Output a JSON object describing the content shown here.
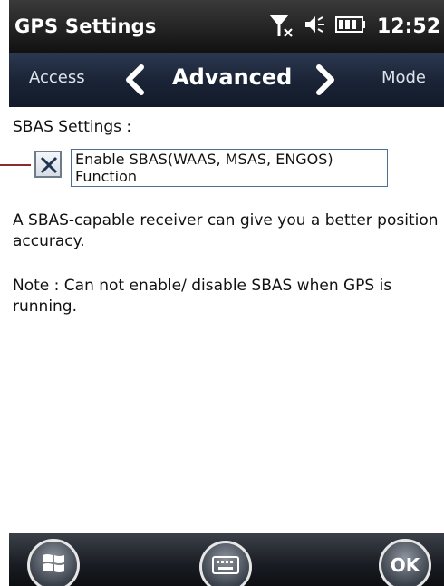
{
  "status_bar": {
    "title": "GPS Settings",
    "time": "12:52",
    "icons": [
      "signal-off-icon",
      "speaker-icon",
      "battery-icon"
    ]
  },
  "nav": {
    "prev_label": "Access",
    "current_label": "Advanced",
    "next_label": "Mode"
  },
  "content": {
    "section_label": "SBAS Settings :",
    "enable_sbas": {
      "checked": true,
      "label_line1": "Enable SBAS(WAAS, MSAS, ENGOS)",
      "label_line2": "Function"
    },
    "description": "A SBAS-capable receiver can give you a better position accuracy.",
    "note": "Note : Can not enable/ disable SBAS when GPS is running."
  },
  "bottom_bar": {
    "start_icon": "windows-start-icon",
    "keyboard_icon": "keyboard-icon",
    "ok_label": "OK"
  },
  "colors": {
    "status_bar_bg": "#1a1a1a",
    "nav_bar_bg": "#1a2335",
    "checkbox_border": "#6e7b8b",
    "label_border": "#4f6d91",
    "pointer_line": "#8a2d2d"
  }
}
